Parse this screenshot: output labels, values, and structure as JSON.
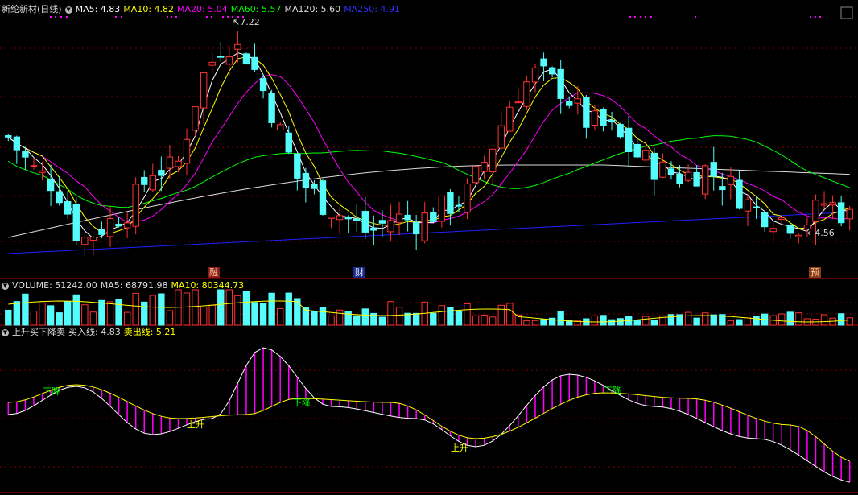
{
  "main_header": {
    "title": "新纶新材(日线)",
    "ma": [
      {
        "label": "MA5: 4.83",
        "color": "#ffffff"
      },
      {
        "label": "MA10: 4.82",
        "color": "#ffff00"
      },
      {
        "label": "MA20: 5.04",
        "color": "#ff00ff"
      },
      {
        "label": "MA60: 5.57",
        "color": "#00ff00"
      },
      {
        "label": "MA120: 5.60",
        "color": "#dddddd"
      },
      {
        "label": "MA250: 4.91",
        "color": "#2020ff"
      }
    ]
  },
  "volume_header": {
    "title": "VOLUME: 51242.00",
    "ma5": "MA5: 68791.98",
    "ma10": "MA10: 80344.73"
  },
  "indicator_header": {
    "title": "上升买下降卖",
    "buy": "买入线: 4.83",
    "sell": "卖出线: 5.21"
  },
  "price_annotations": {
    "high": "7.22",
    "low": "4.56"
  },
  "event_tags": [
    "融",
    "财",
    "预"
  ],
  "signal_labels": [
    "下降",
    "上升",
    "下降",
    "上升",
    "下降"
  ],
  "colors": {
    "up": "#ff3232",
    "down": "#54fcfc",
    "ma5": "#ffffff",
    "ma10": "#ffff00",
    "ma20": "#ff00ff",
    "ma60": "#00ff00",
    "ma120": "#dddddd",
    "ma250": "#2020ff",
    "grid": "#7a0000",
    "signal_up": "#ffff00",
    "signal_down": "#00ff00"
  },
  "chart_data": [
    {
      "type": "candlestick",
      "title": "新纶新材(日线)",
      "days": 100,
      "high": 7.22,
      "low": 4.56,
      "ohlc_anchor_closes": [
        5.9,
        5.5,
        5.3,
        4.6,
        4.8,
        5.0,
        5.5,
        5.5,
        6.6,
        7.1,
        6.9,
        6.2,
        5.4,
        5.1,
        4.9,
        4.7,
        4.9,
        4.85,
        5.0,
        5.15,
        5.7,
        6.4,
        6.7,
        6.5,
        6.1,
        6.0,
        5.7,
        5.5,
        5.4,
        5.5,
        5.3,
        5.0,
        4.9,
        4.8,
        5.1,
        4.9
      ]
    },
    {
      "type": "bar",
      "title": "VOLUME",
      "ma5": 68791.98,
      "ma10": 80344.73,
      "last": 51242.0
    },
    {
      "type": "line",
      "title": "上升买下降卖",
      "buy_line": 4.83,
      "sell_line": 5.21
    }
  ]
}
